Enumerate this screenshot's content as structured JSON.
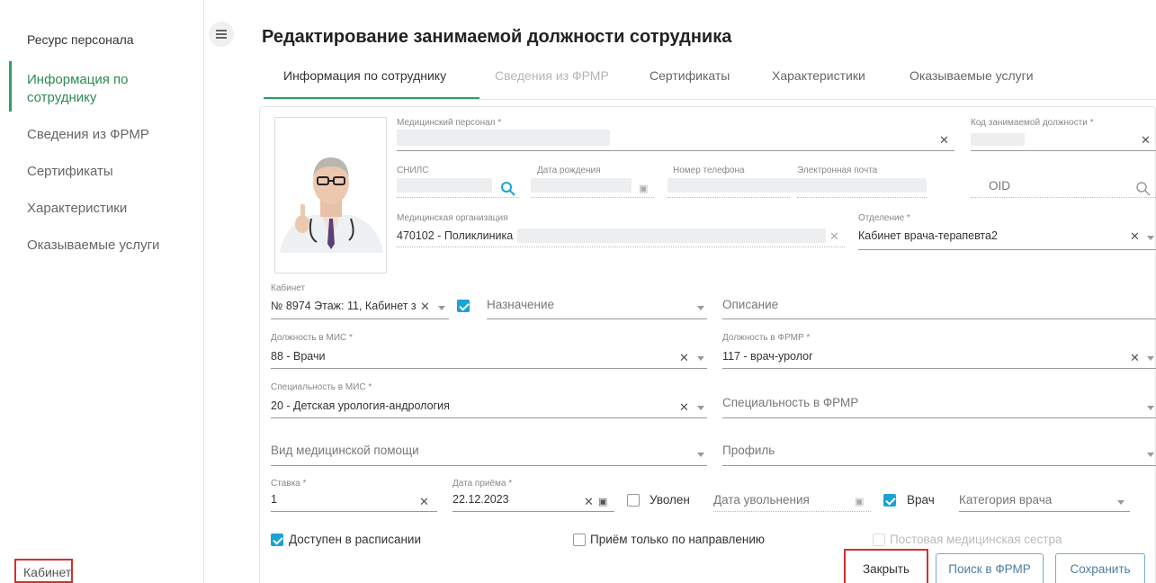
{
  "sidebar": {
    "title": "Ресурс персонала",
    "items": [
      {
        "label": "Информация по"
      },
      {
        "label": "сотруднику"
      },
      {
        "label": "Сведения из ФРМР"
      },
      {
        "label": "Сертификаты"
      },
      {
        "label": "Характеристики"
      },
      {
        "label": "Оказываемые услуги"
      }
    ],
    "bottom": "Кабинет"
  },
  "page": {
    "title": "Редактирование занимаемой должности сотрудника"
  },
  "tabs": [
    {
      "label": "Информация по сотруднику"
    },
    {
      "label": "Сведения из ФРМР"
    },
    {
      "label": "Сертификаты"
    },
    {
      "label": "Характеристики"
    },
    {
      "label": "Оказываемые услуги"
    }
  ],
  "form": {
    "med_personal": {
      "label": "Медицинский персонал *"
    },
    "position_code": {
      "label": "Код занимаемой должности *"
    },
    "snils": {
      "label": "СНИЛС"
    },
    "birth_date": {
      "label": "Дата рождения"
    },
    "phone": {
      "label": "Номер телефона"
    },
    "email": {
      "label": "Электронная почта"
    },
    "oid": {
      "placeholder": "OID"
    },
    "med_org": {
      "label": "Медицинская организация",
      "value": "470102 - Поликлиника"
    },
    "department": {
      "label": "Отделение *",
      "value": "Кабинет врача-терапевта2"
    },
    "cabinet": {
      "label": "Кабинет",
      "value": "№ 8974 Этаж: 11, Кабинет з"
    },
    "purpose": {
      "placeholder": "Назначение"
    },
    "description": {
      "placeholder": "Описание"
    },
    "mis_position": {
      "label": "Должность в МИС *",
      "value": "88 - Врачи"
    },
    "frmr_position": {
      "label": "Должность в ФРМР *",
      "value": "117 - врач-уролог"
    },
    "mis_specialty": {
      "label": "Специальность в МИС *",
      "value": "20 - Детская урология-андрология"
    },
    "frmr_specialty": {
      "placeholder": "Специальность в ФРМР"
    },
    "care_type": {
      "placeholder": "Вид медицинской помощи"
    },
    "profile": {
      "placeholder": "Профиль"
    },
    "rate": {
      "label": "Ставка *",
      "value": "1"
    },
    "hire_date": {
      "label": "Дата приёма *",
      "value": "22.12.2023"
    },
    "dismissed": {
      "label": "Уволен"
    },
    "dismissal_date": {
      "placeholder": "Дата увольнения"
    },
    "doctor": {
      "label": "Врач"
    },
    "doctor_category": {
      "placeholder": "Категория врача"
    },
    "schedule_available": {
      "label": "Доступен в расписании"
    },
    "referral_only": {
      "label": "Приём только по направлению"
    },
    "post_nurse": {
      "label": "Постовая медицинская сестра"
    }
  },
  "buttons": {
    "close": "Закрыть",
    "frmr_search": "Поиск в ФРМР",
    "save": "Сохранить"
  },
  "colors": {
    "accent_green": "#2e9e6b",
    "checkbox_blue": "#1aa3d6",
    "highlight_red": "#d32f2f",
    "button_blue": "#4d7ea3"
  }
}
